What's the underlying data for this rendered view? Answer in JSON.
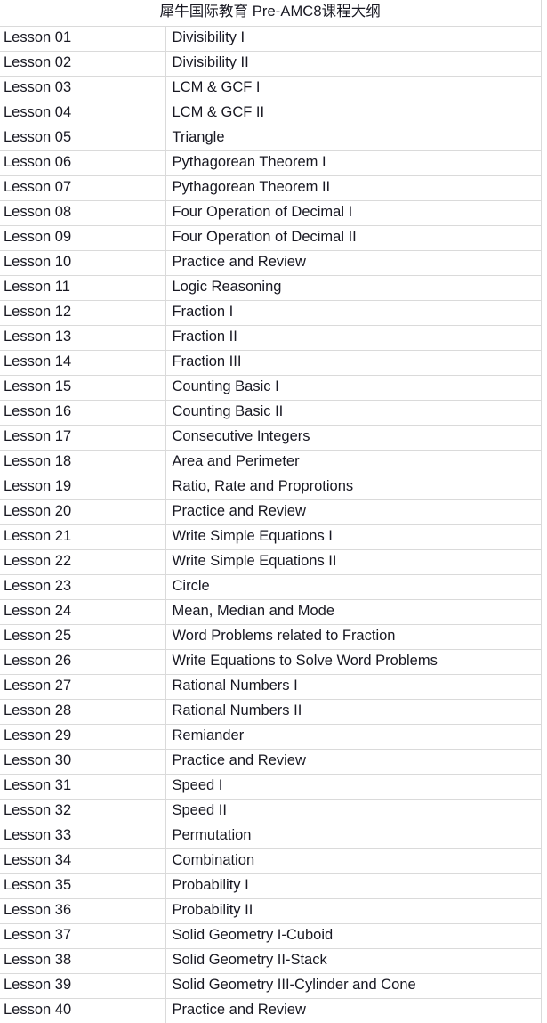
{
  "document": {
    "title": "犀牛国际教育 Pre-AMC8课程大纲",
    "colors": {
      "text": "#181822",
      "border": "#dadada",
      "background": "#ffffff"
    }
  },
  "table": {
    "columns": [
      {
        "key": "lesson",
        "label": ""
      },
      {
        "key": "topic",
        "label": ""
      }
    ],
    "rows": [
      {
        "lesson": "Lesson 01",
        "topic": "Divisibility I"
      },
      {
        "lesson": "Lesson 02",
        "topic": "Divisibility II"
      },
      {
        "lesson": "Lesson 03",
        "topic": "LCM & GCF I"
      },
      {
        "lesson": "Lesson 04",
        "topic": "LCM & GCF II"
      },
      {
        "lesson": "Lesson 05",
        "topic": "Triangle"
      },
      {
        "lesson": "Lesson 06",
        "topic": "Pythagorean Theorem I"
      },
      {
        "lesson": "Lesson 07",
        "topic": "Pythagorean Theorem II"
      },
      {
        "lesson": "Lesson 08",
        "topic": "Four Operation of Decimal I"
      },
      {
        "lesson": "Lesson 09",
        "topic": "Four Operation of Decimal II"
      },
      {
        "lesson": "Lesson 10",
        "topic": "Practice and Review"
      },
      {
        "lesson": "Lesson 11",
        "topic": "Logic Reasoning"
      },
      {
        "lesson": "Lesson 12",
        "topic": "Fraction I"
      },
      {
        "lesson": "Lesson 13",
        "topic": "Fraction II"
      },
      {
        "lesson": "Lesson 14",
        "topic": "Fraction III"
      },
      {
        "lesson": "Lesson 15",
        "topic": "Counting Basic I"
      },
      {
        "lesson": "Lesson 16",
        "topic": "Counting Basic II"
      },
      {
        "lesson": "Lesson 17",
        "topic": "Consecutive Integers"
      },
      {
        "lesson": "Lesson 18",
        "topic": "Area and Perimeter"
      },
      {
        "lesson": "Lesson 19",
        "topic": "Ratio, Rate and Proprotions"
      },
      {
        "lesson": "Lesson 20",
        "topic": "Practice and Review"
      },
      {
        "lesson": "Lesson 21",
        "topic": "Write Simple Equations I"
      },
      {
        "lesson": "Lesson 22",
        "topic": "Write Simple Equations II"
      },
      {
        "lesson": "Lesson 23",
        "topic": "Circle"
      },
      {
        "lesson": "Lesson 24",
        "topic": "Mean, Median and Mode"
      },
      {
        "lesson": "Lesson 25",
        "topic": "Word Problems related to Fraction"
      },
      {
        "lesson": "Lesson 26",
        "topic": "Write Equations to Solve Word Problems"
      },
      {
        "lesson": "Lesson 27",
        "topic": "Rational Numbers I"
      },
      {
        "lesson": "Lesson 28",
        "topic": "Rational Numbers II"
      },
      {
        "lesson": "Lesson 29",
        "topic": "Remiander"
      },
      {
        "lesson": "Lesson 30",
        "topic": "Practice and Review"
      },
      {
        "lesson": "Lesson 31",
        "topic": "Speed I"
      },
      {
        "lesson": "Lesson 32",
        "topic": "Speed II"
      },
      {
        "lesson": "Lesson 33",
        "topic": "Permutation"
      },
      {
        "lesson": "Lesson 34",
        "topic": "Combination"
      },
      {
        "lesson": "Lesson 35",
        "topic": "Probability I"
      },
      {
        "lesson": "Lesson 36",
        "topic": "Probability II"
      },
      {
        "lesson": "Lesson 37",
        "topic": "Solid Geometry I-Cuboid"
      },
      {
        "lesson": "Lesson 38",
        "topic": "Solid Geometry II-Stack"
      },
      {
        "lesson": "Lesson 39",
        "topic": "Solid Geometry III-Cylinder and Cone"
      },
      {
        "lesson": "Lesson 40",
        "topic": "Practice and Review"
      }
    ]
  }
}
